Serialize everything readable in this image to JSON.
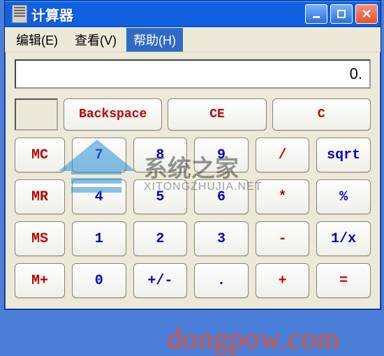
{
  "titlebar": {
    "title": "计算器"
  },
  "menu": {
    "edit": "编辑(E)",
    "view": "查看(V)",
    "help": "帮助(H)"
  },
  "display": {
    "value": "0."
  },
  "topbuttons": {
    "backspace": "Backspace",
    "ce": "CE",
    "c": "C"
  },
  "mem": {
    "mc": "MC",
    "mr": "MR",
    "ms": "MS",
    "mplus": "M+"
  },
  "keys": {
    "k7": "7",
    "k8": "8",
    "k9": "9",
    "div": "/",
    "sqrt": "sqrt",
    "k4": "4",
    "k5": "5",
    "k6": "6",
    "mul": "*",
    "pct": "%",
    "k1": "1",
    "k2": "2",
    "k3": "3",
    "sub": "-",
    "inv": "1/x",
    "k0": "0",
    "pm": "+/-",
    "dot": ".",
    "add": "+",
    "eq": "="
  },
  "watermark": {
    "main": "系统之家",
    "sub": "XITONGZHUJIA.NET",
    "bottom": "dongpow.com"
  }
}
